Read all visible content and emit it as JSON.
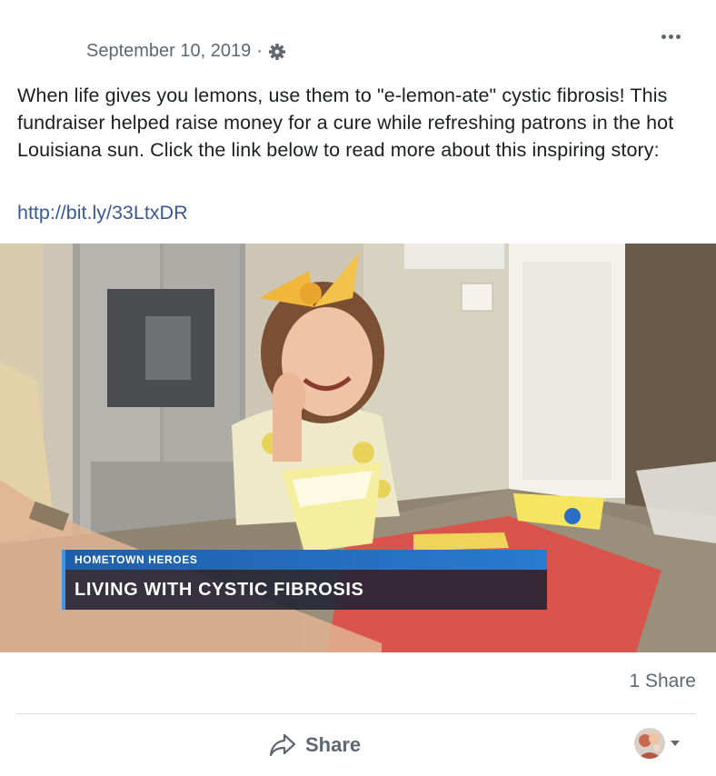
{
  "post": {
    "date": "September 10, 2019",
    "separator": "·",
    "privacy_icon": "gear-icon",
    "more_icon": "more-options-icon",
    "text": "When life gives you lemons, use them to \"e-lemon-ate\" cystic fibrosis! This fundraiser helped raise money for a cure while refreshing patrons in the hot Louisiana sun. Click the link below to read more about this inspiring story:",
    "link": "http://bit.ly/33LtxDR"
  },
  "video": {
    "lower_third_top": "HOMETOWN HEROES",
    "lower_third_title": "LIVING WITH CYSTIC FIBROSIS",
    "accent_color": "#2a7ad1"
  },
  "footer": {
    "share_count": "1 Share",
    "share_label": "Share",
    "share_icon": "share-arrow-icon",
    "avatar_icon": "avatar"
  },
  "colors": {
    "link": "#385898",
    "secondary_text": "#606770",
    "divider": "#dadde1"
  }
}
